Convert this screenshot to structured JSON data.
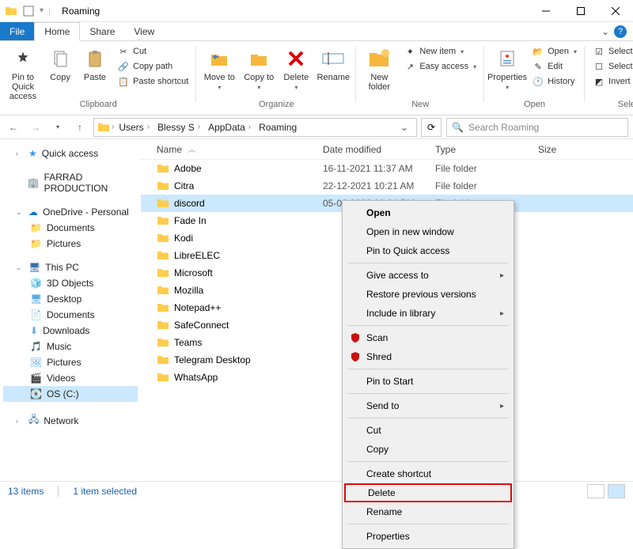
{
  "window": {
    "title": "Roaming"
  },
  "tabs": {
    "file": "File",
    "home": "Home",
    "share": "Share",
    "view": "View"
  },
  "ribbon": {
    "clipboard": {
      "label": "Clipboard",
      "pin": "Pin to Quick access",
      "copy": "Copy",
      "paste": "Paste",
      "cut": "Cut",
      "copypath": "Copy path",
      "pasteshortcut": "Paste shortcut"
    },
    "organize": {
      "label": "Organize",
      "moveto": "Move to",
      "copyto": "Copy to",
      "delete": "Delete",
      "rename": "Rename"
    },
    "new": {
      "label": "New",
      "newfolder": "New folder",
      "newitem": "New item",
      "easyaccess": "Easy access"
    },
    "open": {
      "label": "Open",
      "properties": "Properties",
      "open": "Open",
      "edit": "Edit",
      "history": "History"
    },
    "select": {
      "label": "Select",
      "selectall": "Select all",
      "selectnone": "Select none",
      "invert": "Invert selection"
    }
  },
  "breadcrumbs": [
    "Users",
    "Blessy S",
    "AppData",
    "Roaming"
  ],
  "search": {
    "placeholder": "Search Roaming"
  },
  "columns": {
    "name": "Name",
    "date": "Date modified",
    "type": "Type",
    "size": "Size"
  },
  "rows": [
    {
      "name": "Adobe",
      "date": "16-11-2021 11:37 AM",
      "type": "File folder"
    },
    {
      "name": "Citra",
      "date": "22-12-2021 10:21 AM",
      "type": "File folder"
    },
    {
      "name": "discord",
      "date": "05-02-2022 10:21 PM",
      "type": "File folder",
      "selected": true
    },
    {
      "name": "Fade In",
      "date": "",
      "type": ""
    },
    {
      "name": "Kodi",
      "date": "",
      "type": ""
    },
    {
      "name": "LibreELEC",
      "date": "",
      "type": ""
    },
    {
      "name": "Microsoft",
      "date": "",
      "type": ""
    },
    {
      "name": "Mozilla",
      "date": "",
      "type": ""
    },
    {
      "name": "Notepad++",
      "date": "",
      "type": ""
    },
    {
      "name": "SafeConnect",
      "date": "",
      "type": ""
    },
    {
      "name": "Teams",
      "date": "",
      "type": ""
    },
    {
      "name": "Telegram Desktop",
      "date": "",
      "type": ""
    },
    {
      "name": "WhatsApp",
      "date": "",
      "type": ""
    }
  ],
  "sidebar": {
    "quick": "Quick access",
    "farrad": "FARRAD PRODUCTION",
    "onedrive": "OneDrive - Personal",
    "onedrive_children": [
      "Documents",
      "Pictures"
    ],
    "thispc": "This PC",
    "thispc_children": [
      "3D Objects",
      "Desktop",
      "Documents",
      "Downloads",
      "Music",
      "Pictures",
      "Videos",
      "OS (C:)"
    ],
    "network": "Network"
  },
  "context": {
    "open": "Open",
    "newwin": "Open in new window",
    "pinqa": "Pin to Quick access",
    "giveaccess": "Give access to",
    "restore": "Restore previous versions",
    "include": "Include in library",
    "scan": "Scan",
    "shred": "Shred",
    "pinstart": "Pin to Start",
    "sendto": "Send to",
    "cut": "Cut",
    "copy": "Copy",
    "shortcut": "Create shortcut",
    "delete": "Delete",
    "rename": "Rename",
    "properties": "Properties"
  },
  "status": {
    "count": "13 items",
    "sel": "1 item selected"
  }
}
